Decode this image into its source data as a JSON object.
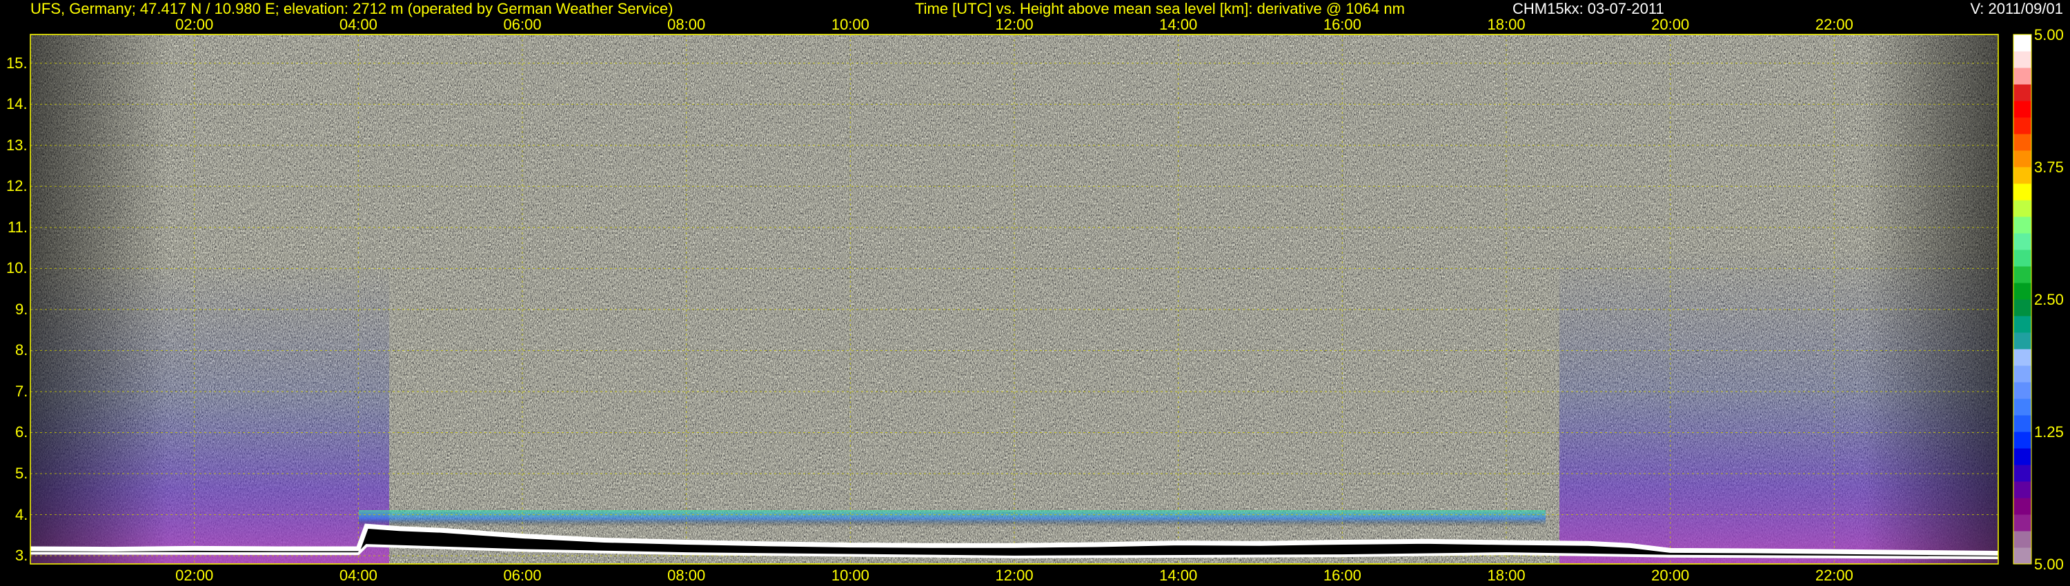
{
  "header": {
    "site": "UFS, Germany; 47.417 N / 10.980 E; elevation: 2712 m  (operated by German Weather Service)",
    "title": "Time [UTC] vs. Height above mean sea level [km]: derivative @ 1064 nm",
    "device": "CHM15kx: 03-07-2011",
    "version": "V: 2011/09/01"
  },
  "chart_data": {
    "type": "heatmap",
    "title": "Time [UTC] vs. Height above mean sea level [km]: derivative @ 1064 nm",
    "xlabel": "Time [UTC]",
    "ylabel": "Height above mean sea level [km]",
    "xlim": [
      0,
      24
    ],
    "ylim": [
      2.8,
      15.7
    ],
    "x_ticks": [
      "02:00",
      "04:00",
      "06:00",
      "08:00",
      "10:00",
      "12:00",
      "14:00",
      "16:00",
      "18:00",
      "20:00",
      "22:00"
    ],
    "x_tick_hours": [
      2,
      4,
      6,
      8,
      10,
      12,
      14,
      16,
      18,
      20,
      22
    ],
    "y_ticks": [
      "3.",
      "4.",
      "5.",
      "6.",
      "7.",
      "8.",
      "9.",
      "10.",
      "11.",
      "12.",
      "13.",
      "14.",
      "15."
    ],
    "y_tick_values": [
      3,
      4,
      5,
      6,
      7,
      8,
      9,
      10,
      11,
      12,
      13,
      14,
      15
    ],
    "grid": true,
    "colorbar": {
      "tick_labels": [
        "5.00",
        "3.75",
        "2.50",
        "1.25",
        "5.00"
      ],
      "tick_values": [
        5.0,
        3.75,
        2.5,
        1.25,
        0.0
      ],
      "colors": [
        "#b090b0",
        "#a070a0",
        "#902090",
        "#800080",
        "#6000a0",
        "#3000c0",
        "#0000e0",
        "#0030ff",
        "#2060ff",
        "#4080ff",
        "#6090ff",
        "#80a8ff",
        "#a0c0ff",
        "#20a0a0",
        "#00a080",
        "#009040",
        "#00a020",
        "#20c040",
        "#40e080",
        "#60f0a0",
        "#80ff80",
        "#c0ff40",
        "#ffff00",
        "#ffc000",
        "#ff9000",
        "#ff6000",
        "#ff2000",
        "#ff0000",
        "#e02020",
        "#ffa0a0",
        "#ffe0e0",
        "#ffffff"
      ]
    },
    "boundary_layer_top_km": [
      [
        0.0,
        3.17
      ],
      [
        1.0,
        3.16
      ],
      [
        2.0,
        3.18
      ],
      [
        3.0,
        3.17
      ],
      [
        4.0,
        3.17
      ],
      [
        4.1,
        3.72
      ],
      [
        4.5,
        3.66
      ],
      [
        5.0,
        3.62
      ],
      [
        6.0,
        3.48
      ],
      [
        7.0,
        3.38
      ],
      [
        8.0,
        3.33
      ],
      [
        9.0,
        3.29
      ],
      [
        10.0,
        3.26
      ],
      [
        11.0,
        3.25
      ],
      [
        12.0,
        3.25
      ],
      [
        13.0,
        3.27
      ],
      [
        14.0,
        3.31
      ],
      [
        15.0,
        3.3
      ],
      [
        16.0,
        3.33
      ],
      [
        17.0,
        3.35
      ],
      [
        18.0,
        3.32
      ],
      [
        19.0,
        3.3
      ],
      [
        19.5,
        3.25
      ],
      [
        20.0,
        3.13
      ],
      [
        21.0,
        3.12
      ],
      [
        22.0,
        3.1
      ],
      [
        23.0,
        3.08
      ],
      [
        24.0,
        3.06
      ]
    ],
    "boundary_layer_base_km": [
      [
        0.0,
        3.06
      ],
      [
        4.0,
        3.05
      ],
      [
        4.1,
        3.25
      ],
      [
        6.0,
        3.13
      ],
      [
        8.0,
        3.05
      ],
      [
        12.0,
        2.97
      ],
      [
        16.0,
        3.0
      ],
      [
        18.0,
        3.05
      ],
      [
        20.0,
        2.99
      ],
      [
        24.0,
        2.95
      ]
    ]
  }
}
